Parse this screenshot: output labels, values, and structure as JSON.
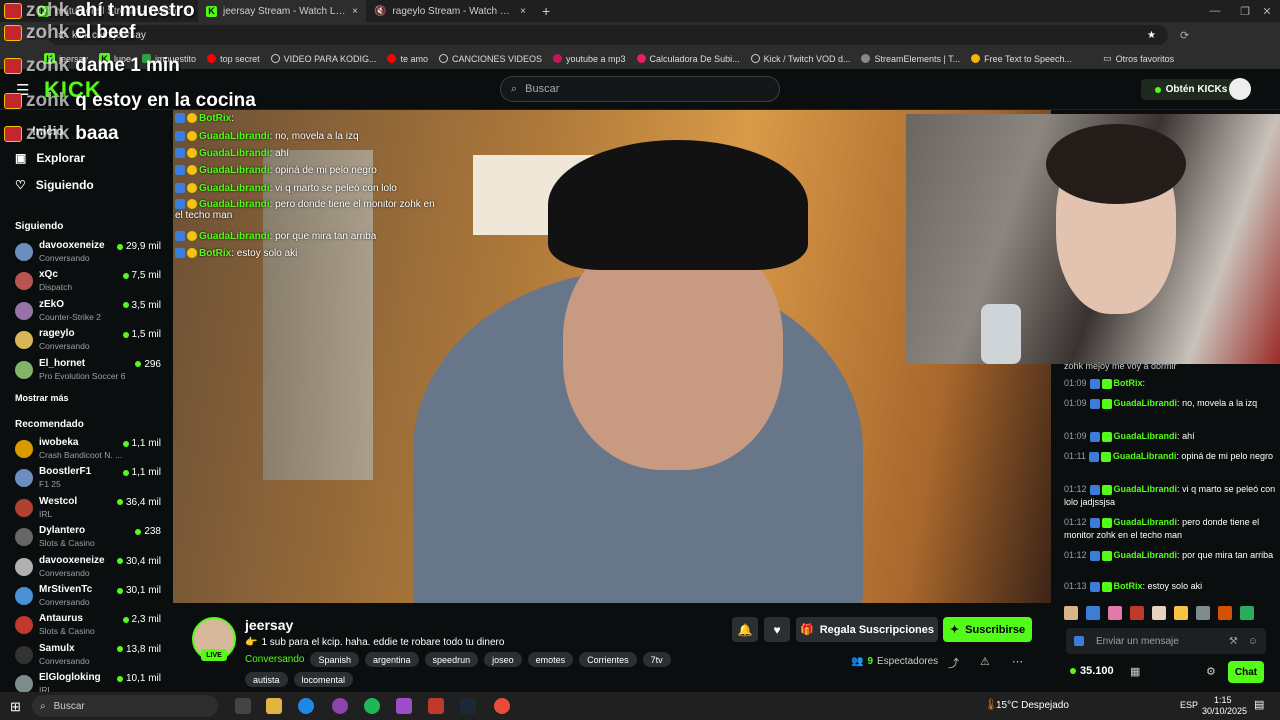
{
  "browser": {
    "tabs": [
      {
        "title": "matumoreil Stream - Watch"
      },
      {
        "title": "jeersay Stream - Watch Live"
      },
      {
        "title": "rageylo Stream - Watch Live"
      }
    ],
    "new_tab": "+",
    "url": "kick.com/jeersay",
    "bookmarks": [
      "jeersay",
      "lupe",
      "impuestito",
      "top secret",
      "VIDEO PARA KODIG...",
      "te amo",
      "CANCIONES VIDEOS",
      "youtube a mp3",
      "Calculadora De Subi...",
      "Kick / Twitch VOD d...",
      "StreamElements | T...",
      "Free Text to Speech..."
    ],
    "bookmarks_other": "Otros favoritos"
  },
  "kick": {
    "logo": "KICK",
    "search_placeholder": "Buscar",
    "get_kicks": "Obtén KICKs"
  },
  "nav": {
    "menu": [
      {
        "label": "Inicio"
      },
      {
        "label": "Explorar"
      },
      {
        "label": "Siguiendo"
      }
    ],
    "following_title": "Siguiendo",
    "following": [
      {
        "name": "davooxeneize",
        "game": "Conversando",
        "viewers": "29,9 mil"
      },
      {
        "name": "xQc",
        "game": "Dispatch",
        "viewers": "7,5 mil"
      },
      {
        "name": "zEkO",
        "game": "Counter-Strike 2",
        "viewers": "3,5 mil"
      },
      {
        "name": "rageylo",
        "game": "Conversando",
        "viewers": "1,5 mil"
      },
      {
        "name": "El_hornet",
        "game": "Pro Evolution Soccer 6",
        "viewers": "296"
      }
    ],
    "show_more": "Mostrar más",
    "recommended_title": "Recomendado",
    "recommended": [
      {
        "name": "iwobeka",
        "game": "Crash Bandicoot N. ...",
        "viewers": "1,1 mil"
      },
      {
        "name": "BoostlerF1",
        "game": "F1 25",
        "viewers": "1,1 mil"
      },
      {
        "name": "Westcol",
        "game": "IRL",
        "viewers": "36,4 mil"
      },
      {
        "name": "Dylantero",
        "game": "Slots & Casino",
        "viewers": "238"
      },
      {
        "name": "davooxeneize",
        "game": "Conversando",
        "viewers": "30,4 mil"
      },
      {
        "name": "MrStivenTc",
        "game": "Conversando",
        "viewers": "30,1 mil"
      },
      {
        "name": "Antaurus",
        "game": "Slots & Casino",
        "viewers": "2,3 mil"
      },
      {
        "name": "Samulx",
        "game": "Conversando",
        "viewers": "13,8 mil"
      },
      {
        "name": "ElGlogloking",
        "game": "IRL",
        "viewers": "10,1 mil"
      }
    ]
  },
  "overlay_big": [
    {
      "user": "zohk",
      "text": "ahí t muestro"
    },
    {
      "user": "zohk",
      "text": "el beef"
    },
    {
      "user": "zohk",
      "text": "dame 1 min"
    },
    {
      "user": "zohk",
      "text": "q estoy en la cocina"
    },
    {
      "user": "zohk",
      "text": "baaa"
    }
  ],
  "overlay_chat": [
    {
      "user": "BotRix",
      "text": ""
    },
    {
      "user": "GuadaLibrandi",
      "text": "no, movela a la izq"
    },
    {
      "user": "GuadaLibrandi",
      "text": "ahí"
    },
    {
      "user": "GuadaLibrandi",
      "text": "opiná de mi pelo negro"
    },
    {
      "user": "GuadaLibrandi",
      "text": "vi q marto se peleó con lolo"
    },
    {
      "user": "GuadaLibrandi",
      "text": "pero donde tiene el monitor zohk en el techo man"
    },
    {
      "user": "GuadaLibrandi",
      "text": "por que mira tan arriba"
    },
    {
      "user": "BotRix",
      "text": "estoy solo aki"
    }
  ],
  "stream": {
    "streamer": "jeersay",
    "live": "LIVE",
    "title": "1 sub para el kcip. haha. eddie te robare todo tu dinero",
    "category": "Conversando",
    "tags": [
      "Spanish",
      "argentina",
      "speedrun",
      "joseo",
      "emotes",
      "Corrientes",
      "7tv",
      "autista",
      "locomental"
    ],
    "gift_subs": "Regala Suscripciones",
    "subscribe": "Suscribirse",
    "viewers": "9",
    "viewers_label": "Espectadores"
  },
  "chat": {
    "top_partial": "zohk mejoy me voy a dormir",
    "messages": [
      {
        "time": "01:09",
        "user": "BotRix",
        "text": ""
      },
      {
        "time": "01:09",
        "user": "GuadaLibrandi",
        "text": "no, movela a la izq"
      },
      {
        "time": "01:09",
        "user": "GuadaLibrandi",
        "text": "ahí"
      },
      {
        "time": "01:11",
        "user": "GuadaLibrandi",
        "text": "opiná de mi pelo negro"
      },
      {
        "time": "01:12",
        "user": "GuadaLibrandi",
        "text": "vi q marto se peleó con lolo jadjssjsa"
      },
      {
        "time": "01:12",
        "user": "GuadaLibrandi",
        "text": "pero donde tiene el monitor zohk en el techo man"
      },
      {
        "time": "01:12",
        "user": "GuadaLibrandi",
        "text": "por que mira tan arriba"
      },
      {
        "time": "01:13",
        "user": "BotRix",
        "text": "estoy solo aki"
      }
    ],
    "placeholder": "Enviar un mensaje",
    "kicks": "35.100",
    "send": "Chat"
  },
  "taskbar": {
    "search": "Buscar",
    "weather": "15°C  Despejado",
    "lang": "ESP",
    "time": "1:15",
    "date": "30/10/2025"
  },
  "colors": {
    "accent": "#53fc18",
    "bg": "#0b0e0f"
  }
}
